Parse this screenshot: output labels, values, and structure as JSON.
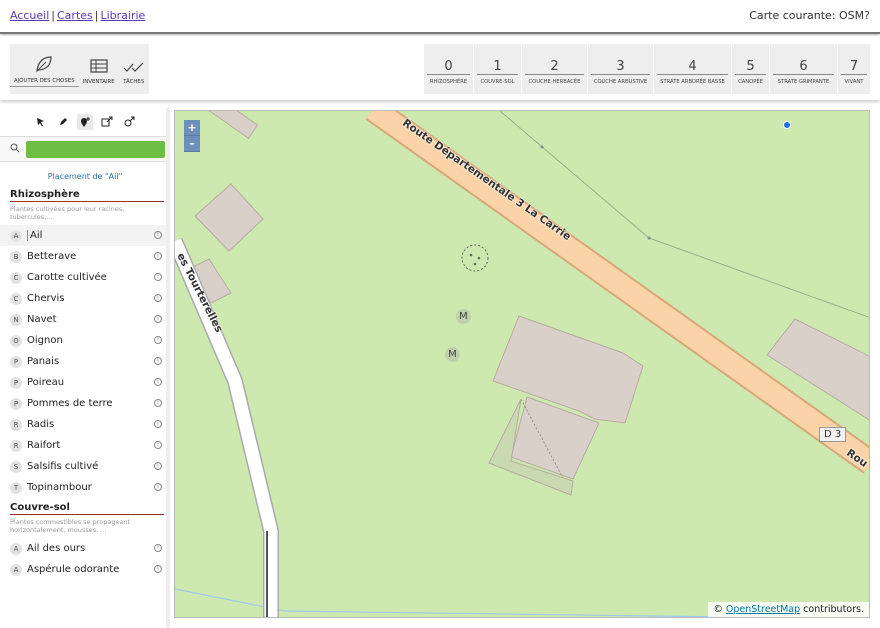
{
  "nav": {
    "links": [
      "Accueil",
      "Cartes",
      "Librairie"
    ],
    "current_map": "Carte courante: OSM?"
  },
  "tools": [
    {
      "label": "Ajouter des choses",
      "icon": "leaf-icon"
    },
    {
      "label": "Inventaire",
      "icon": "table-icon"
    },
    {
      "label": "Tâches",
      "icon": "checkmarks-icon"
    }
  ],
  "strata": [
    {
      "num": "0",
      "label": "Rhizosphère"
    },
    {
      "num": "1",
      "label": "Couvre-sol"
    },
    {
      "num": "2",
      "label": "Couche herbacée"
    },
    {
      "num": "3",
      "label": "Couche arbustive"
    },
    {
      "num": "4",
      "label": "Strate arborée basse"
    },
    {
      "num": "5",
      "label": "Canopée"
    },
    {
      "num": "6",
      "label": "Strate grimpante"
    },
    {
      "num": "7",
      "label": "Vivant"
    }
  ],
  "sidebar": {
    "placing": "Placement de \"Ail\"",
    "sections": [
      {
        "title": "Rhizosphère",
        "desc": "Plantes cultivées pour leur racines, tubercules,...",
        "items": [
          {
            "letter": "A",
            "name": "Ail"
          },
          {
            "letter": "B",
            "name": "Betterave"
          },
          {
            "letter": "C",
            "name": "Carotte cultivée"
          },
          {
            "letter": "C",
            "name": "Chervis"
          },
          {
            "letter": "N",
            "name": "Navet"
          },
          {
            "letter": "O",
            "name": "Oignon"
          },
          {
            "letter": "P",
            "name": "Panais"
          },
          {
            "letter": "P",
            "name": "Poireau"
          },
          {
            "letter": "P",
            "name": "Pommes de terre"
          },
          {
            "letter": "R",
            "name": "Radis"
          },
          {
            "letter": "R",
            "name": "Raifort"
          },
          {
            "letter": "S",
            "name": "Salsifis cultivé"
          },
          {
            "letter": "T",
            "name": "Topinambour"
          }
        ]
      },
      {
        "title": "Couvre-sol",
        "desc": "Plantes commestibles se propageant horizontalement, mousses, ...",
        "items": [
          {
            "letter": "A",
            "name": "Ail des ours"
          },
          {
            "letter": "A",
            "name": "Aspérule odorante"
          }
        ]
      }
    ]
  },
  "map": {
    "zoom_in": "+",
    "zoom_out": "–",
    "road_main": "Route Départementale 3 La Carrie",
    "road_side": "es Tourterelles",
    "road_end": "Rou",
    "road_ref": "D 3",
    "marker": "M",
    "attribution_prefix": "©",
    "attribution_link": "OpenStreetMap",
    "attribution_suffix": "contributors."
  }
}
